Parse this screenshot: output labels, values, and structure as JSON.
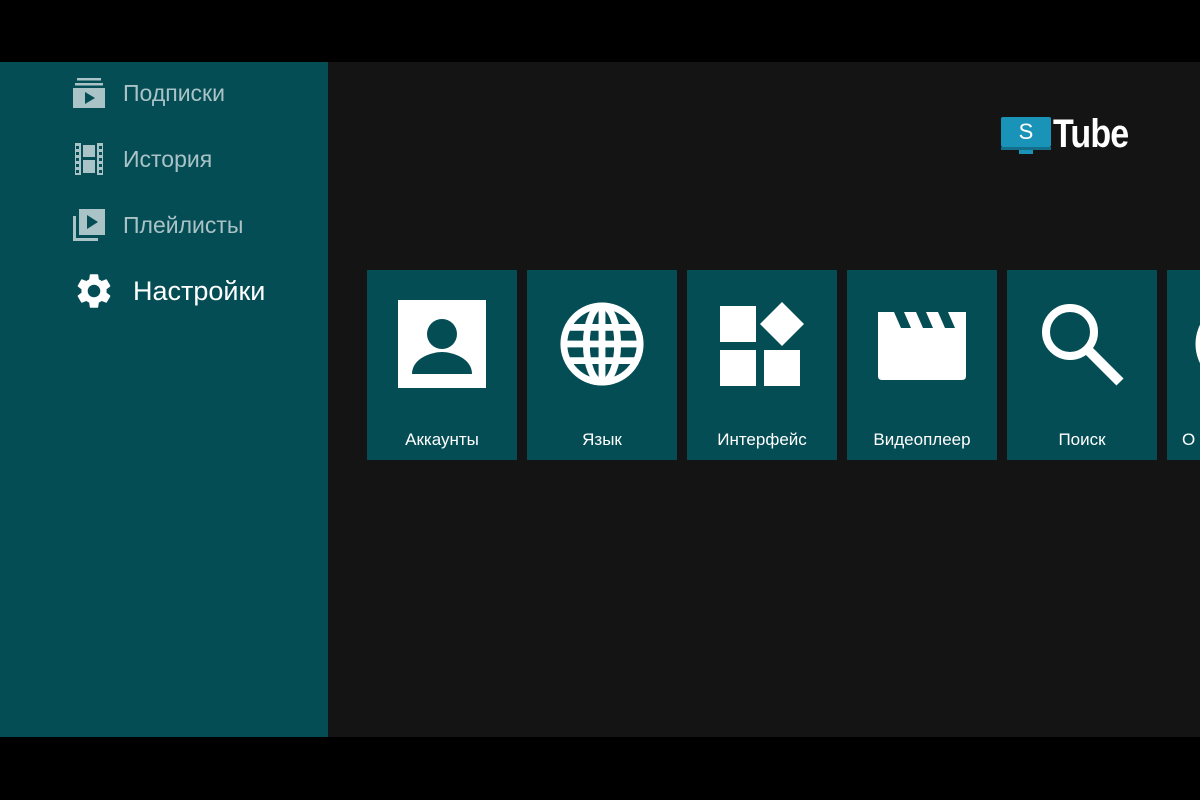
{
  "sidebar": {
    "items": [
      {
        "label": "Подписки",
        "icon": "subscriptions-icon"
      },
      {
        "label": "История",
        "icon": "history-film-icon"
      },
      {
        "label": "Плейлисты",
        "icon": "playlists-icon"
      },
      {
        "label": "Настройки",
        "icon": "gear-icon",
        "active": true
      }
    ]
  },
  "logo": {
    "badge_letter": "S",
    "word": "Tube"
  },
  "settings": {
    "cards": [
      {
        "label": "Аккаунты",
        "icon": "account-icon"
      },
      {
        "label": "Язык",
        "icon": "globe-icon"
      },
      {
        "label": "Интерфейс",
        "icon": "widgets-icon"
      },
      {
        "label": "Видеоплеер",
        "icon": "clapperboard-icon"
      },
      {
        "label": "Поиск",
        "icon": "search-icon"
      },
      {
        "label": "О",
        "icon": "info-icon"
      }
    ]
  },
  "colors": {
    "accent": "#054d55",
    "background": "#141414",
    "logo_blue": "#1a93b8"
  }
}
